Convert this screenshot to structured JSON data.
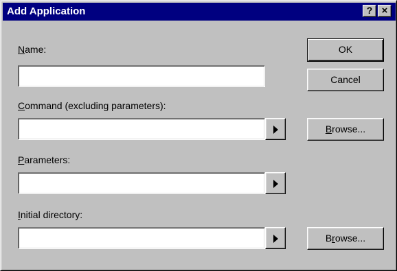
{
  "window": {
    "title": "Add Application",
    "help_label": "?",
    "close_label": "×"
  },
  "fields": {
    "name": {
      "label_u": "N",
      "label_rest": "ame:",
      "value": ""
    },
    "command": {
      "label_u": "C",
      "label_rest": "ommand (excluding parameters):",
      "value": ""
    },
    "parameters": {
      "label_u": "P",
      "label_rest": "arameters:",
      "value": ""
    },
    "directory": {
      "label_u": "I",
      "label_rest": "nitial directory:",
      "value": ""
    }
  },
  "buttons": {
    "ok": "OK",
    "cancel": "Cancel",
    "browse1_u": "B",
    "browse1_rest": "rowse...",
    "browse2_pre": "B",
    "browse2_u": "r",
    "browse2_rest": "owse..."
  },
  "icons": {
    "arrow": "right-triangle-icon"
  }
}
